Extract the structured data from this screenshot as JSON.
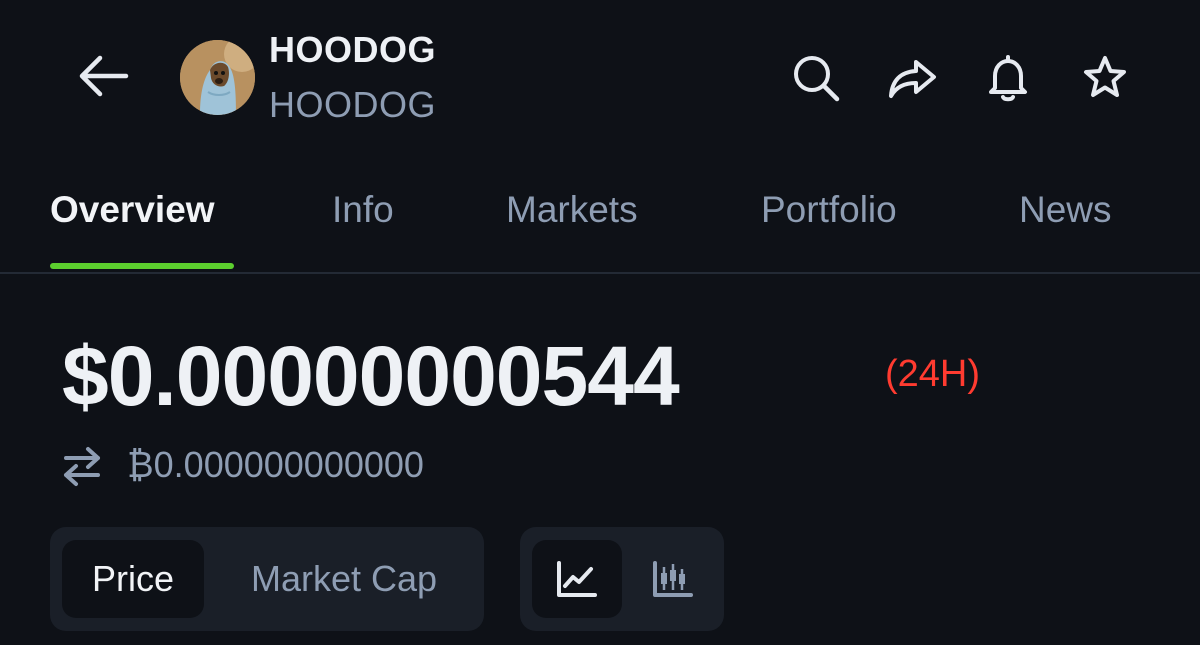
{
  "header": {
    "title": "HOODOG",
    "symbol": "HOODOG",
    "icons": {
      "back": "arrow-left-icon",
      "search": "search-icon",
      "share": "share-icon",
      "alert": "bell-icon",
      "favorite": "star-icon"
    }
  },
  "tabs": [
    {
      "label": "Overview",
      "active": true
    },
    {
      "label": "Info",
      "active": false
    },
    {
      "label": "Markets",
      "active": false
    },
    {
      "label": "Portfolio",
      "active": false
    },
    {
      "label": "News",
      "active": false
    }
  ],
  "price": {
    "usd": "$0.00000000544",
    "change_label": "(24H)",
    "btc": "₿0.000000000000"
  },
  "chart_controls": {
    "metric_options": [
      {
        "label": "Price",
        "selected": true
      },
      {
        "label": "Market Cap",
        "selected": false
      }
    ],
    "chart_types": [
      {
        "icon": "line-chart-icon",
        "selected": true
      },
      {
        "icon": "candlestick-chart-icon",
        "selected": false
      }
    ]
  },
  "colors": {
    "background": "#0e1117",
    "accent": "#5ccf2e",
    "negative": "#ff3b30",
    "muted_text": "#8e9db3"
  }
}
